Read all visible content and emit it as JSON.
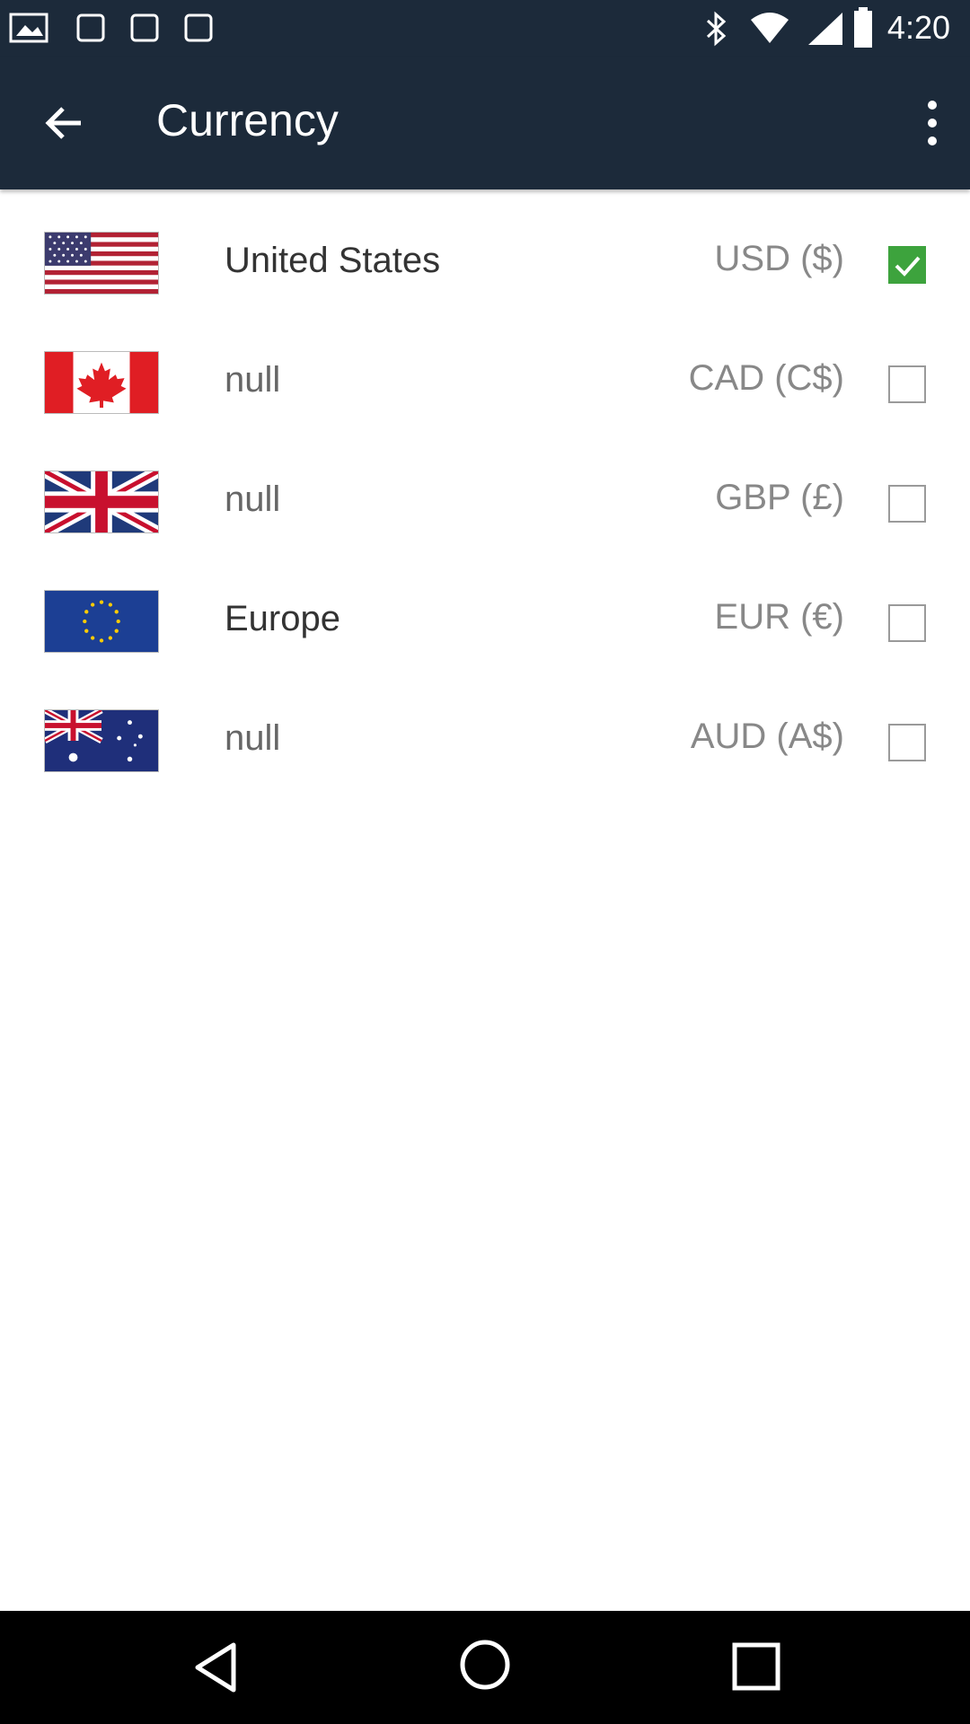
{
  "status_bar": {
    "time": "4:20",
    "icons": [
      "image-notif-icon",
      "notif-icon",
      "notif-icon",
      "notif-icon",
      "bluetooth-icon",
      "wifi-icon",
      "signal-icon",
      "battery-icon"
    ]
  },
  "app_bar": {
    "title": "Currency",
    "back_icon": "arrow-back-icon",
    "menu_icon": "more-vert-icon",
    "background_color": "#1c2a3a"
  },
  "currencies": [
    {
      "country": "United States",
      "code": "USD ($)",
      "flag": "us-flag-icon",
      "checked": true
    },
    {
      "country": "null",
      "code": "CAD (C$)",
      "flag": "canada-flag-icon",
      "checked": false
    },
    {
      "country": "null",
      "code": "GBP (£)",
      "flag": "uk-flag-icon",
      "checked": false
    },
    {
      "country": "Europe",
      "code": "EUR (€)",
      "flag": "eu-flag-icon",
      "checked": false
    },
    {
      "country": "null",
      "code": "AUD (A$)",
      "flag": "australia-flag-icon",
      "checked": false
    }
  ],
  "colors": {
    "check_green": "#3da33d"
  },
  "nav_bar": {
    "icons": [
      "nav-back-icon",
      "nav-home-icon",
      "nav-recents-icon"
    ]
  }
}
